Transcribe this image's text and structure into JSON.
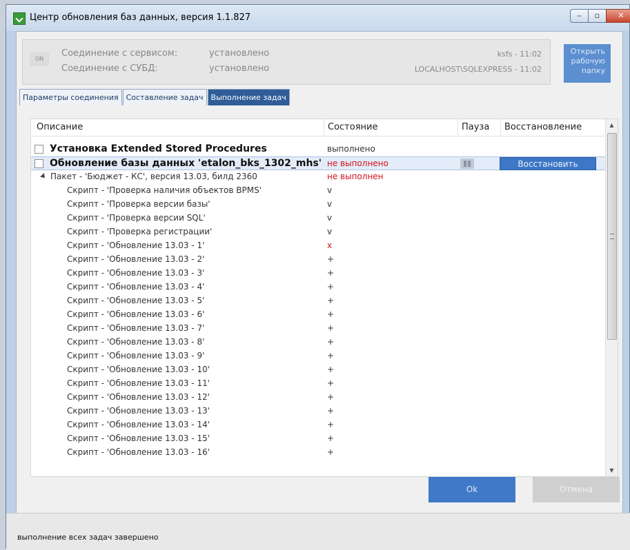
{
  "window": {
    "title": "Центр обновления баз данных, версия 1.1.827"
  },
  "connection": {
    "badge": "ON",
    "service_label": "Соединение с сервисом:",
    "service_value": "установлено",
    "dbms_label": "Соединение с СУБД:",
    "dbms_value": "установлено",
    "service_right": "ksfs - 11:02",
    "dbms_right": "LOCALHOST\\SQLEXPRESS - 11:02"
  },
  "open_folder_button": {
    "line1": "Открыть",
    "line2": "рабочую",
    "line3": "папку"
  },
  "tabs": [
    {
      "label": "Параметры соединения",
      "active": false
    },
    {
      "label": "Составление задач",
      "active": false
    },
    {
      "label": "Выполнение задач",
      "active": true
    }
  ],
  "grid": {
    "columns": {
      "description": "Описание",
      "state": "Состояние",
      "pause": "Пауза",
      "restore": "Восстановление"
    },
    "rows": [
      {
        "desc": "Установка Extended Stored Procedures",
        "state": "выполнено",
        "kind": "task"
      },
      {
        "desc": "Обновление базы данных 'etalon_bks_1302_mhs'",
        "state": "не выполнено",
        "kind": "task-selected",
        "restore_label": "Восстановить"
      },
      {
        "desc": "Пакет - 'Бюджет - КС', версия 13.03, билд 2360",
        "state": "не выполнен",
        "kind": "package"
      },
      {
        "desc": "Скрипт - 'Проверка наличия объектов BPMS'",
        "state": "v"
      },
      {
        "desc": "Скрипт - 'Проверка версии базы'",
        "state": "v"
      },
      {
        "desc": "Скрипт - 'Проверка версии SQL'",
        "state": "v"
      },
      {
        "desc": "Скрипт - 'Проверка регистрации'",
        "state": "v"
      },
      {
        "desc": "Скрипт - 'Обновление 13.03 - 1'",
        "state": "x"
      },
      {
        "desc": "Скрипт - 'Обновление 13.03 - 2'",
        "state": "+"
      },
      {
        "desc": "Скрипт - 'Обновление 13.03 - 3'",
        "state": "+"
      },
      {
        "desc": "Скрипт - 'Обновление 13.03 - 4'",
        "state": "+"
      },
      {
        "desc": "Скрипт - 'Обновление 13.03 - 5'",
        "state": "+"
      },
      {
        "desc": "Скрипт - 'Обновление 13.03 - 6'",
        "state": "+"
      },
      {
        "desc": "Скрипт - 'Обновление 13.03 - 7'",
        "state": "+"
      },
      {
        "desc": "Скрипт - 'Обновление 13.03 - 8'",
        "state": "+"
      },
      {
        "desc": "Скрипт - 'Обновление 13.03 - 9'",
        "state": "+"
      },
      {
        "desc": "Скрипт - 'Обновление 13.03 - 10'",
        "state": "+"
      },
      {
        "desc": "Скрипт - 'Обновление 13.03 - 11'",
        "state": "+"
      },
      {
        "desc": "Скрипт - 'Обновление 13.03 - 12'",
        "state": "+"
      },
      {
        "desc": "Скрипт - 'Обновление 13.03 - 13'",
        "state": "+"
      },
      {
        "desc": "Скрипт - 'Обновление 13.03 - 14'",
        "state": "+"
      },
      {
        "desc": "Скрипт - 'Обновление 13.03 - 15'",
        "state": "+"
      },
      {
        "desc": "Скрипт - 'Обновление 13.03 - 16'",
        "state": "+"
      }
    ]
  },
  "buttons": {
    "ok": "Ok",
    "cancel": "Отмена"
  },
  "status_bar": "выполнение всех задач завершено",
  "colors": {
    "accent": "#3d77c6",
    "error": "#d2121a",
    "active_tab": "#2f5d97"
  }
}
